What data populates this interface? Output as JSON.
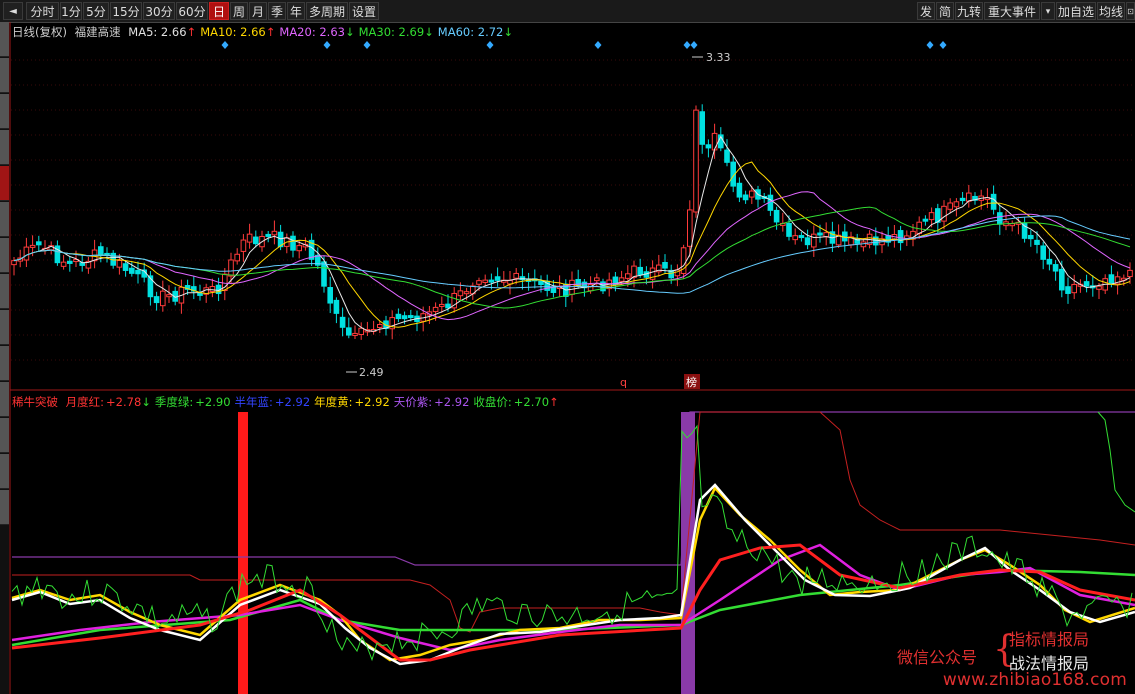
{
  "toolbar": {
    "left": [
      "◄",
      "分时",
      "1分",
      "5分",
      "15分",
      "30分",
      "60分",
      "日",
      "周",
      "月",
      "季",
      "年",
      "多周期",
      "设置"
    ],
    "active": "日",
    "right": [
      "发",
      "简",
      "九转",
      "重大事件",
      "▾",
      "加自选",
      "均线",
      "⊡"
    ]
  },
  "leftbar": {
    "tabs": 14,
    "active_index": 4
  },
  "upper": {
    "period": "日线(复权)",
    "stock_name": "福建高速",
    "ma": [
      {
        "label": "MA5: 2.66",
        "arrow": "↑",
        "color": "#e0e0e0",
        "arrow_color": "#ff3333"
      },
      {
        "label": "MA10: 2.66",
        "arrow": "↑",
        "color": "#ffd700",
        "arrow_color": "#ff3333"
      },
      {
        "label": "MA20: 2.63",
        "arrow": "↓",
        "color": "#e066ff",
        "arrow_color": "#33dd33"
      },
      {
        "label": "MA30: 2.69",
        "arrow": "↓",
        "color": "#33dd33",
        "arrow_color": "#33dd33"
      },
      {
        "label": "MA60: 2.72",
        "arrow": "↓",
        "color": "#66ccff",
        "arrow_color": "#33dd33"
      }
    ],
    "high_label": "3.33",
    "low_label": "2.49",
    "marker_q": "q",
    "marker_bang": "榜"
  },
  "lower": {
    "indicator": "稀牛突破",
    "items": [
      {
        "label": "月度红:",
        "value": "+2.78",
        "arrow": "↓",
        "color": "#ff3333",
        "arrow_color": "#33dd33"
      },
      {
        "label": "季度绿:",
        "value": "+2.90",
        "arrow": "",
        "color": "#33dd33",
        "arrow_color": ""
      },
      {
        "label": "半年蓝:",
        "value": "+2.92",
        "arrow": "",
        "color": "#3344ff",
        "arrow_color": ""
      },
      {
        "label": "年度黄:",
        "value": "+2.92",
        "arrow": "",
        "color": "#ffd700",
        "arrow_color": ""
      },
      {
        "label": "天价紫:",
        "value": "+2.92",
        "arrow": "",
        "color": "#aa55ee",
        "arrow_color": ""
      },
      {
        "label": "收盘价:",
        "value": "+2.70",
        "arrow": "↑",
        "color": "#33dd33",
        "arrow_color": "#ff3333"
      }
    ]
  },
  "watermark": {
    "left": "微信公众号",
    "right1": "指标情报局",
    "right2": "战法情报局",
    "url": "www.zhibiao168.com"
  }
}
